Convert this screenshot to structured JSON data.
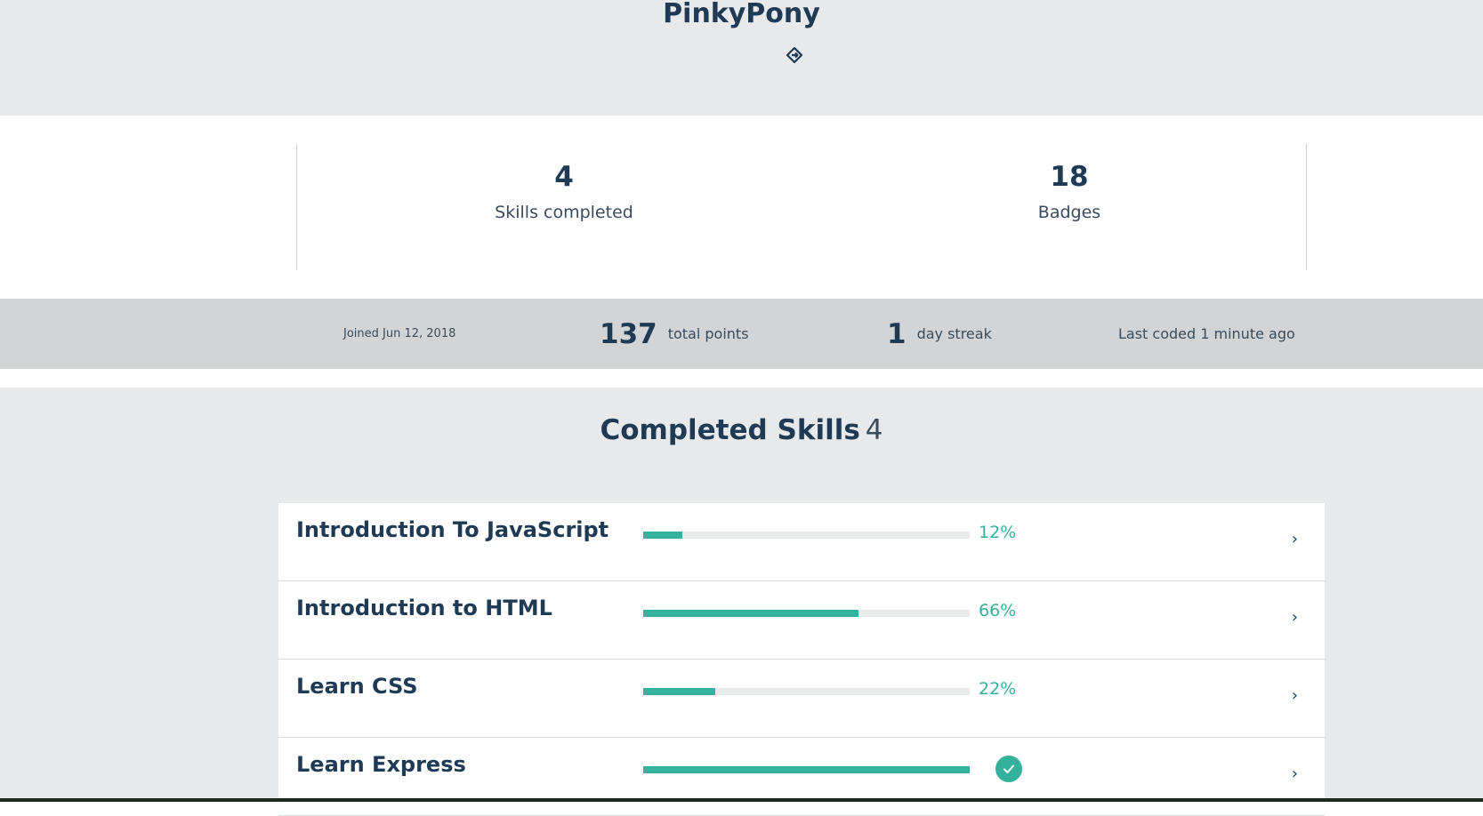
{
  "profile": {
    "username": "PinkyPony",
    "icon": "link-icon"
  },
  "stats": {
    "skills_completed_count": "4",
    "skills_completed_label": "Skills completed",
    "badges_count": "18",
    "badges_label": "Badges"
  },
  "summary_bar": {
    "joined": "Joined Jun 12, 2018",
    "points_value": "137",
    "points_label": "total points",
    "streak_value": "1",
    "streak_label": "day streak",
    "last_coded": "Last coded 1 minute ago"
  },
  "completed_skills": {
    "title": "Completed Skills",
    "count": "4",
    "items": [
      {
        "name": "Introduction To JavaScript",
        "progress": 12,
        "progress_label": "12%",
        "completed": false
      },
      {
        "name": "Introduction to HTML",
        "progress": 66,
        "progress_label": "66%",
        "completed": false
      },
      {
        "name": "Learn CSS",
        "progress": 22,
        "progress_label": "22%",
        "completed": false
      },
      {
        "name": "Learn Express",
        "progress": 100,
        "progress_label": "",
        "completed": true
      }
    ]
  },
  "colors": {
    "accent": "#34b19c",
    "text": "#1f3a55",
    "header_bg": "#e8e9ea",
    "bar_bg": "#d3d4d6"
  }
}
